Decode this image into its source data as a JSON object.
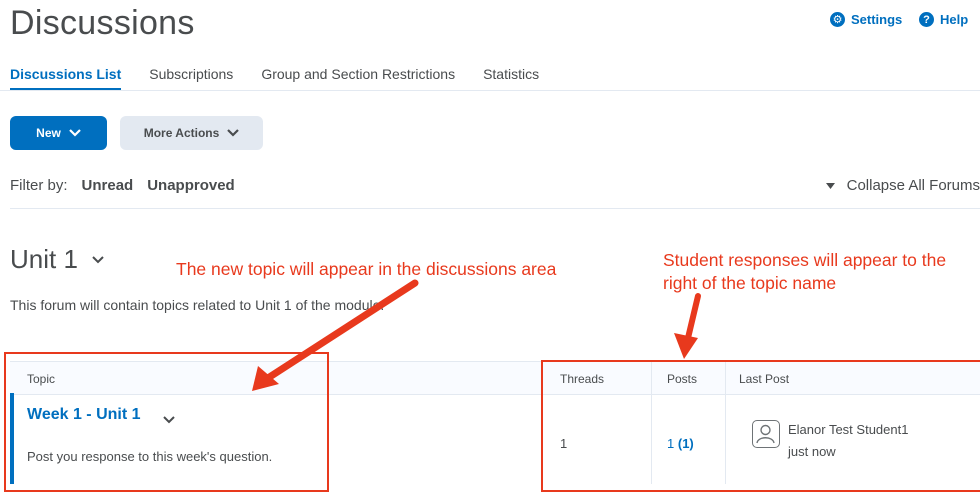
{
  "page": {
    "title": "Discussions",
    "settings_label": "Settings",
    "help_label": "Help"
  },
  "tabs": [
    "Discussions List",
    "Subscriptions",
    "Group and Section Restrictions",
    "Statistics"
  ],
  "actions": {
    "new_label": "New",
    "more_label": "More Actions"
  },
  "filter": {
    "label": "Filter by:",
    "options": [
      "Unread",
      "Unapproved"
    ],
    "collapse_label": "Collapse All Forums"
  },
  "forum": {
    "title": "Unit 1",
    "description": "This forum will contain topics related to Unit 1 of the module."
  },
  "annotations": {
    "left": "The new topic will appear in the discussions area",
    "right_line1": "Student responses will appear to the",
    "right_line2": "right of the topic name",
    "color": "#e8391d"
  },
  "table": {
    "headers": [
      "Topic",
      "Threads",
      "Posts",
      "Last Post"
    ],
    "row": {
      "title": "Week 1 - Unit 1",
      "description": "Post you response to this week's question.",
      "threads": "1",
      "posts": "1",
      "posts_unread": "(1)",
      "last_post_user": "Elanor Test Student1",
      "last_post_time": "just now"
    }
  },
  "colors": {
    "accent": "#006fbf",
    "text": "#494c4e",
    "light_bg": "#e3e9f1"
  }
}
